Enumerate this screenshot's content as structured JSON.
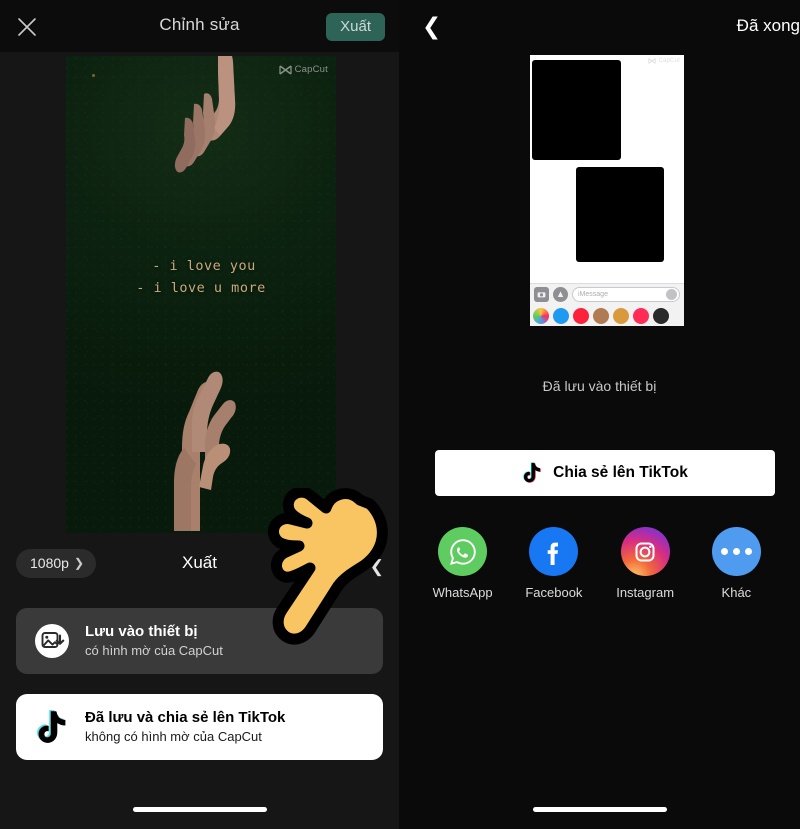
{
  "left_panel": {
    "header": {
      "close_icon": "close-x-icon",
      "title": "Chỉnh sửa",
      "export_button": "Xuất"
    },
    "video_preview": {
      "watermark": "CapCut",
      "caption_line1": "- i love you",
      "caption_line2": "- i love u more",
      "background_color": "#0c2210",
      "caption_color": "#c8ab7c"
    },
    "export_bar": {
      "resolution": "1080p",
      "resolution_chevron": "chevron-right-icon",
      "title": "Xuất",
      "collapse_chevron": "chevron-left-icon"
    },
    "options": [
      {
        "icon": "save-to-device-icon",
        "title": "Lưu vào thiết bị",
        "subtitle": "có hình mờ của CapCut"
      },
      {
        "icon": "tiktok-icon",
        "title": "Đã lưu và chia sẻ lên TikTok",
        "subtitle": "không có hình mờ của CapCut"
      }
    ]
  },
  "right_panel": {
    "header": {
      "back_icon": "chevron-left-icon",
      "done_button": "Đã xong"
    },
    "imessage_preview": {
      "watermark": "CapCut",
      "input_placeholder": "iMessage",
      "camera_icon": "camera-icon",
      "appstore_icon": "app-store-icon",
      "send_icon": "send-arrow-icon",
      "drawer_app_colors": [
        "#f5c542",
        "#1e9bf0",
        "#fa233b",
        "#b07a52",
        "#d99a3e",
        "#ff2d55",
        "#2a2a2a"
      ]
    },
    "status_text": "Đã lưu vào thiết bị",
    "tiktok_button": {
      "icon": "tiktok-icon",
      "label": "Chia sẻ lên TikTok"
    },
    "share_targets": [
      {
        "label": "WhatsApp",
        "icon": "whatsapp-icon",
        "color": "#5fcc62"
      },
      {
        "label": "Facebook",
        "icon": "facebook-icon",
        "color": "#1877f2"
      },
      {
        "label": "Instagram",
        "icon": "instagram-icon",
        "color": "#d92e7f"
      },
      {
        "label": "Khác",
        "icon": "more-dots-icon",
        "color": "#4f9bf0"
      }
    ]
  },
  "cursor": {
    "icon": "pointing-hand-cursor",
    "fill": "#f9c462",
    "outline": "#000000"
  }
}
